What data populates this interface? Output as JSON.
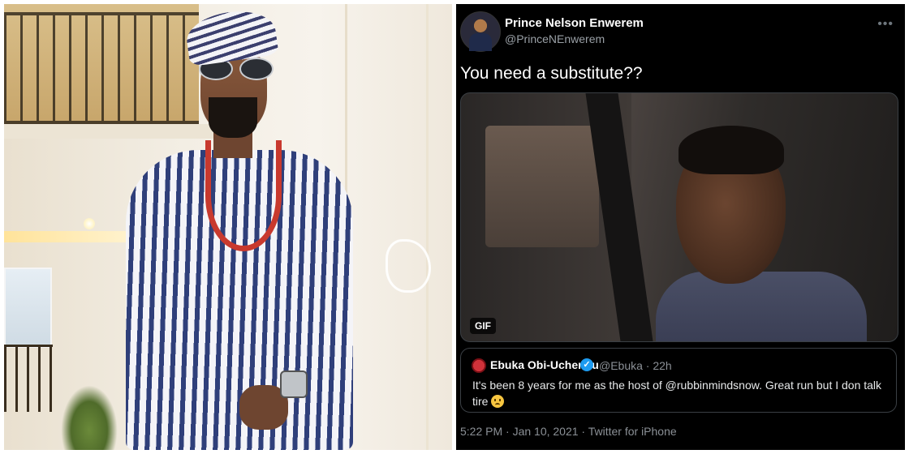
{
  "tweet": {
    "author": {
      "name": "Prince Nelson Enwerem",
      "handle": "@PrinceNEnwerem"
    },
    "text": "You need a substitute??",
    "media": {
      "badge": "GIF"
    },
    "quoted": {
      "name": "Ebuka Obi-Uchendu",
      "verified_icon": "✓",
      "meta": "@Ebuka · 22h",
      "text": "It's been 8 years for me as the host of @rubbinmindsnow. Great run but I don talk tire"
    },
    "timestamp": "5:22 PM · Jan 10, 2021 · Twitter for iPhone",
    "more_icon": "•••"
  },
  "colors": {
    "tweet_bg": "#000000",
    "verified": "#1d9bf0",
    "secondary_text": "#8b9096"
  }
}
